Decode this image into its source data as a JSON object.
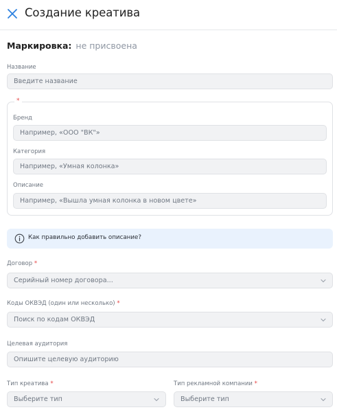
{
  "header": {
    "title": "Создание креатива"
  },
  "marking": {
    "label": "Маркировка:",
    "value": "не присвоена"
  },
  "fields": {
    "name": {
      "label": "Название",
      "placeholder": "Введите название"
    },
    "group_required_mark": "*",
    "brand": {
      "label": "Бренд",
      "placeholder": "Например, «ООО \"ВК\"»"
    },
    "category": {
      "label": "Категория",
      "placeholder": "Например,  «Умная колонка»"
    },
    "description": {
      "label": "Описание",
      "placeholder": "Например, «Вышла умная колонка в новом цвете»"
    },
    "contract": {
      "label": "Договор",
      "required": "*",
      "placeholder": "Серийный номер договора..."
    },
    "okved": {
      "label": "Коды ОКВЭД (один или несколько)",
      "required": "*",
      "placeholder": "Поиск по кодам ОКВЭД"
    },
    "audience": {
      "label": "Целевая аудитория",
      "placeholder": "Опишите целевую аудиторию"
    },
    "creative_type": {
      "label": "Тип креатива",
      "required": "*",
      "placeholder": "Выберите тип"
    },
    "campaign_type": {
      "label": "Тип рекламной компании",
      "required": "*",
      "placeholder": "Выберите тип"
    }
  },
  "info": {
    "text": "Как правильно добавить описание?",
    "icon": "info-circle-icon"
  },
  "colors": {
    "accent": "#2d81e0",
    "required": "#e64646",
    "info_bg": "#e9f2fd",
    "field_bg": "#f1f2f4"
  }
}
